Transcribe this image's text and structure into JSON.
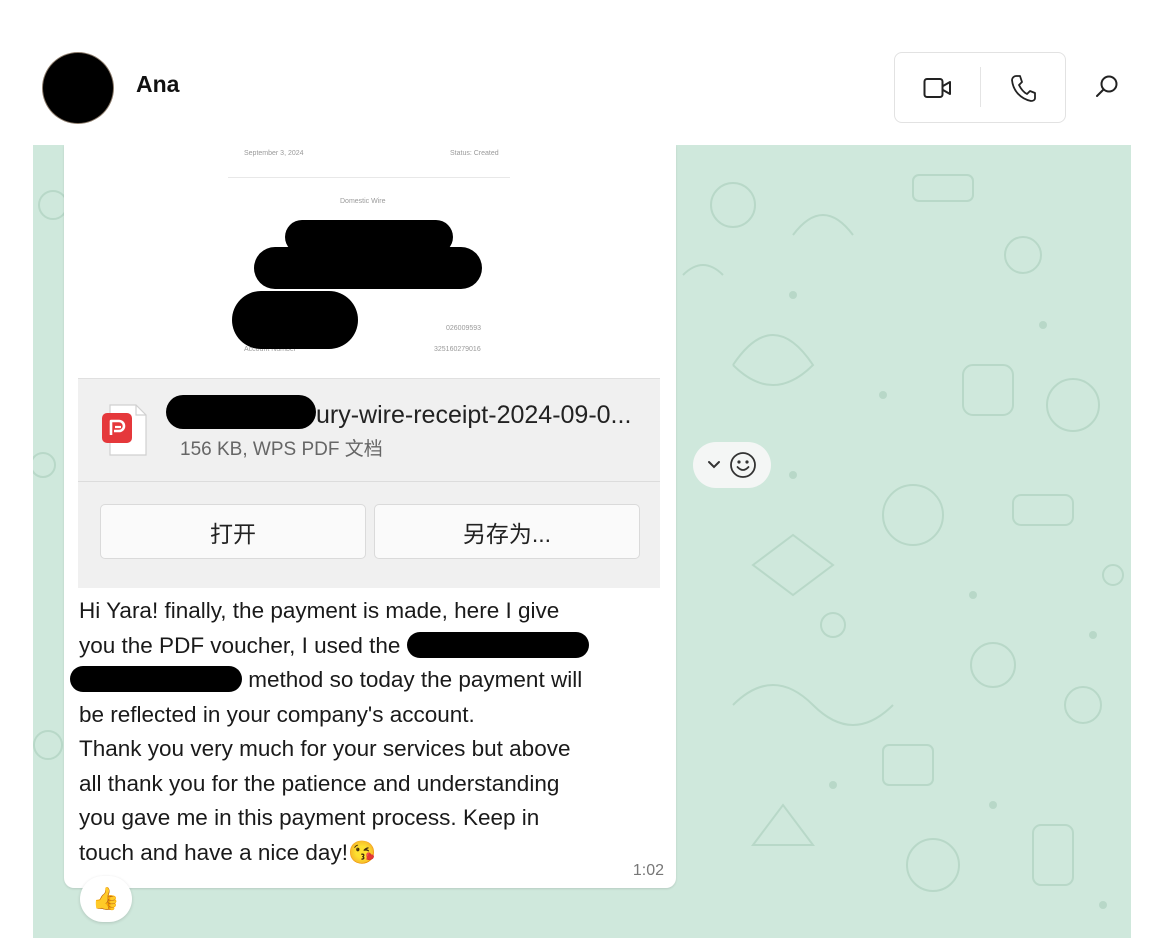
{
  "header": {
    "contact_name": "Ana",
    "icons": [
      "video-call-icon",
      "voice-call-icon",
      "search-icon"
    ]
  },
  "document_preview": {
    "date": "September 3, 2024",
    "status": "Status: Created",
    "doc_title": "Domestic Wire",
    "routing_number": "026009593",
    "account_label": "Account Number",
    "account_number": "325160279016"
  },
  "file": {
    "name_visible": "ury-wire-receipt-2024-09-0...",
    "meta": "156 KB, WPS PDF 文档",
    "icon": "wps-pdf-icon",
    "open_label": "打开",
    "save_as_label": "另存为..."
  },
  "message": {
    "line1": "Hi Yara! finally, the payment is made, here I give",
    "line2a": "you the PDF voucher, I used the",
    "line3b": "method so today the payment will",
    "line4": "be reflected in your company's account.",
    "line5": "Thank you very much for your services but above",
    "line6": "all thank you for the patience and understanding",
    "line7": "you gave me in this payment process. Keep in",
    "line8": "touch and have a nice day!",
    "emoji": "😘",
    "time": "1:02"
  },
  "reaction": {
    "emoji": "👍"
  },
  "colors": {
    "chat_bg": "#cfe8dc",
    "pdf_icon_red": "#e5383b"
  }
}
